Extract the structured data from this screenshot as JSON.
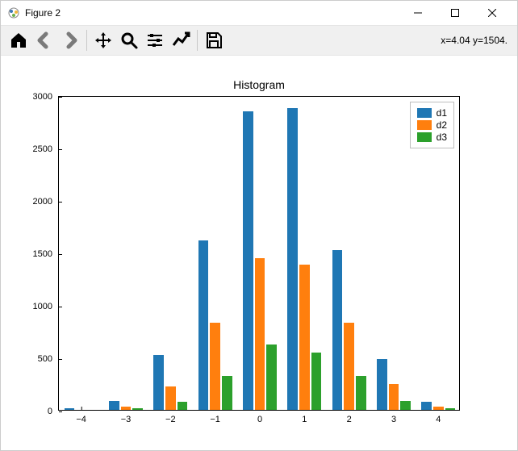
{
  "window": {
    "title": "Figure 2",
    "min_icon": "minimize-icon",
    "max_icon": "maximize-icon",
    "close_icon": "close-icon"
  },
  "toolbar": {
    "coords": "x=4.04 y=1504.",
    "buttons": {
      "home": "home-icon",
      "back": "back-icon",
      "forward": "forward-icon",
      "pan": "pan-icon",
      "zoom": "zoom-icon",
      "subplots": "subplots-icon",
      "axes": "axes-icon",
      "save": "save-icon"
    }
  },
  "chart_data": {
    "type": "bar",
    "title": "Histogram",
    "xlabel": "",
    "ylabel": "",
    "xlim": [
      -4.5,
      4.5
    ],
    "ylim": [
      0,
      3000
    ],
    "yticks": [
      0,
      500,
      1000,
      1500,
      2000,
      2500,
      3000
    ],
    "xticks": [
      -4,
      -3,
      -2,
      -1,
      0,
      1,
      2,
      3,
      4
    ],
    "categories": [
      -4,
      -3,
      -2,
      -1,
      0,
      1,
      2,
      3,
      4
    ],
    "series": [
      {
        "name": "d1",
        "color": "#1f77b4",
        "values": [
          10,
          80,
          520,
          1610,
          2840,
          2870,
          1520,
          480,
          70,
          15
        ]
      },
      {
        "name": "d2",
        "color": "#ff7f0e",
        "values": [
          0,
          30,
          220,
          830,
          1440,
          1380,
          830,
          240,
          30,
          0
        ]
      },
      {
        "name": "d3",
        "color": "#2ca02c",
        "values": [
          0,
          15,
          70,
          320,
          620,
          540,
          320,
          80,
          10,
          0
        ]
      }
    ],
    "bin_edges": [
      -4.5,
      -3.5,
      -2.5,
      -1.5,
      -0.5,
      0.5,
      1.5,
      2.5,
      3.5,
      4.5
    ],
    "legend_position": "upper right"
  }
}
